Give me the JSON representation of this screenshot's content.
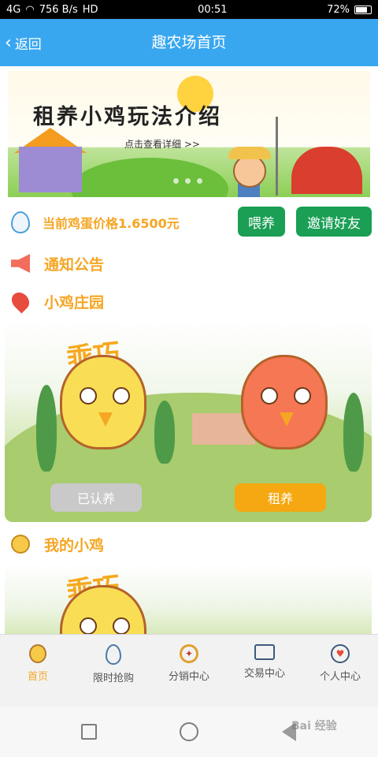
{
  "status_bar": {
    "signal": "4G",
    "net_speed": "756 B/s",
    "hd": "HD",
    "time": "00:51",
    "battery": "72%"
  },
  "header": {
    "back_label": "返回",
    "title": "趣农场首页"
  },
  "banner": {
    "headline": "租养小鸡玩法介绍",
    "subtext": "点击查看详细 >>"
  },
  "price": {
    "text": "当前鸡蛋价格1.6500元",
    "feed_button": "喂养",
    "invite_button": "邀请好友"
  },
  "sections": {
    "notice": "通知公告",
    "farm": "小鸡庄园",
    "my_chicken": "我的小鸡"
  },
  "farm": {
    "adopted_button": "已认养",
    "rent_button": "租养",
    "sign_text": "乖巧"
  },
  "tabs": [
    {
      "label": "首页",
      "icon": "chick-icon"
    },
    {
      "label": "限时抢购",
      "icon": "egg-icon"
    },
    {
      "label": "分销中心",
      "icon": "medal-icon"
    },
    {
      "label": "交易中心",
      "icon": "mail-icon"
    },
    {
      "label": "个人中心",
      "icon": "heart-bubble-icon"
    }
  ],
  "colors": {
    "header_blue": "#39a7f0",
    "accent_orange": "#f5a623",
    "button_green": "#1a9f55"
  },
  "watermark": "Bai 经验"
}
